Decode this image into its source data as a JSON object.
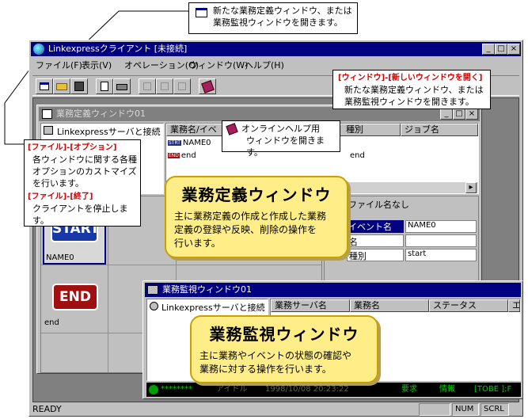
{
  "callouts": {
    "top": {
      "icon": "new-window-icon",
      "line1": "新たな業務定義ウィンドウ、または",
      "line2": "業務監視ウィンドウを開きます。"
    },
    "right": {
      "title": "[ウィンドウ]-[新しいウィンドウを開く]",
      "line1": "新たな業務定義ウィンドウ、または",
      "line2": "業務監視ウィンドウを開きます。"
    },
    "help": {
      "icon": "help-book-icon",
      "line1": "オンラインヘルプ用",
      "line2": "ウィンドウを開きます。"
    },
    "file": {
      "title1": "[ファイル]-[オプション]",
      "desc1a": "各ウィンドウに関する各種",
      "desc1b": "オプションのカストマイズ",
      "desc1c": "を行います。",
      "title2": "[ファイル]-[終了]",
      "desc2": "クライアントを停止します。"
    }
  },
  "app": {
    "title": "Linkexpressクライアント [未接続]",
    "menu": [
      "ファイル(F)",
      "表示(V)",
      "オペレーション(O)",
      "ウィンドウ(W)",
      "ヘルプ(H)"
    ],
    "status": {
      "ready": "READY",
      "num": "NUM",
      "scrl": "SCRL"
    }
  },
  "define_window": {
    "title": "業務定義ウィンドウ01",
    "tree_root": "Linkexpressサーバと接続し",
    "headers": [
      "業務名/イベ",
      "種別",
      "ジョブ名"
    ],
    "rows": [
      {
        "badge": "STRT",
        "name": "NAME0"
      },
      {
        "badge": "END",
        "name": "end"
      }
    ],
    "row_tail": "end",
    "props_title": "ファイル名なし",
    "props": [
      {
        "k": "イベント名",
        "v": "NAME0"
      },
      {
        "k": "名",
        "v": ""
      },
      {
        "k": "種別",
        "v": "start"
      }
    ],
    "start_label": "START",
    "start_caption": "NAME0",
    "end_label": "END",
    "end_caption": "end"
  },
  "monitor_window": {
    "title": "業務監視ウィンドウ01",
    "tree_root": "Linkexpressサーバと接続し",
    "headers": [
      "業務サーバ名",
      "業務名",
      "ステータス",
      "エ"
    ],
    "status_left": "********",
    "status_mid1": "アイドル",
    "status_mid2": "1998/10/08 20:23:22",
    "status_req": "要求",
    "status_info": "情報",
    "status_tobe": "[TOBE ]:F"
  },
  "notes": {
    "define": {
      "title": "業務定義ウィンドウ",
      "l1": "主に業務定義の作成と作成した業務",
      "l2": "定義の登録や反映、削除の操作を",
      "l3": "行います。"
    },
    "monitor": {
      "title": "業務監視ウィンドウ",
      "l1": "主に業務やイベントの状態の確認や",
      "l2": "業務に対する操作を行います。"
    }
  }
}
